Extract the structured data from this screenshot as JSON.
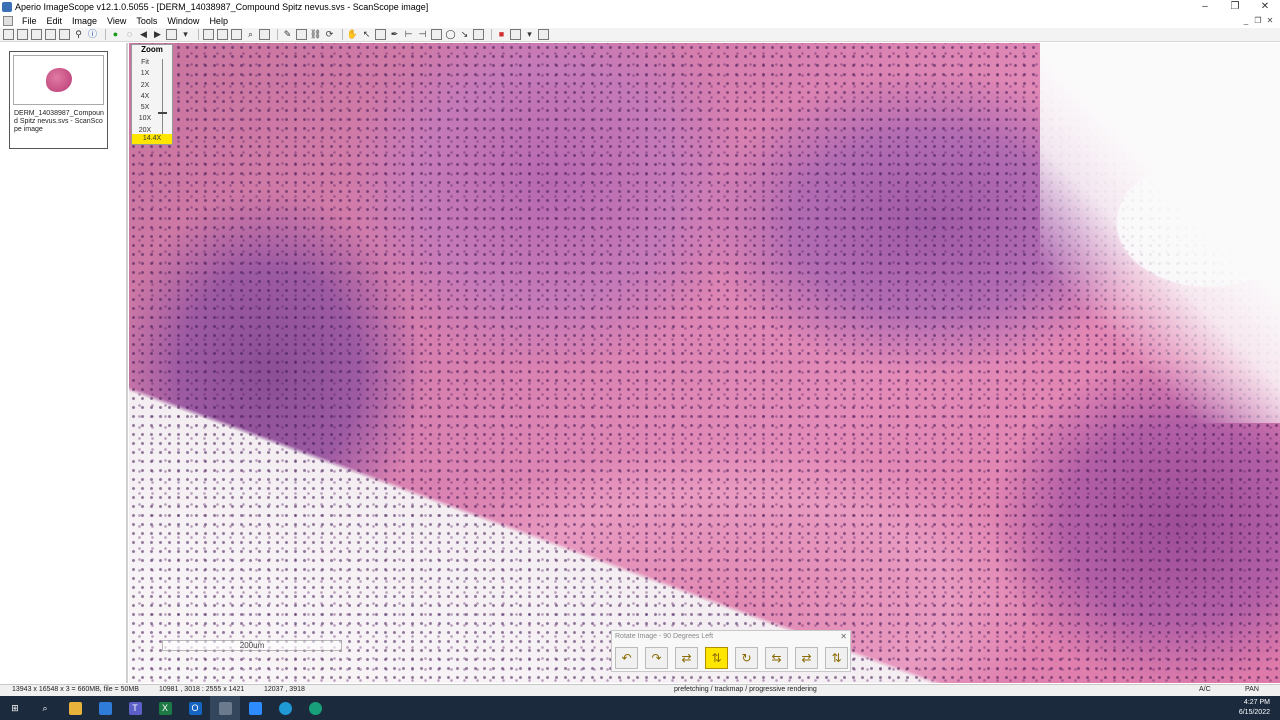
{
  "window": {
    "title": "Aperio ImageScope v12.1.0.5055 - [DERM_14038987_Compound Spitz nevus.svs - ScanScope image]",
    "minimize": "–",
    "restore": "❐",
    "close": "✕"
  },
  "menu": {
    "items": [
      "File",
      "Edit",
      "Image",
      "View",
      "Tools",
      "Window",
      "Help"
    ]
  },
  "mdi": {
    "minimize": "_",
    "restore": "❐",
    "close": "✕"
  },
  "thumbnail": {
    "label": "DERM_14038987_Compound Spitz nevus.svs - ScanScope image"
  },
  "zoom": {
    "title": "Zoom",
    "levels": [
      "Fit",
      "1X",
      "2X",
      "4X",
      "5X",
      "10X",
      "20X"
    ],
    "current": "14.4X",
    "fraction": 0.72
  },
  "scalebar": {
    "label": "200um"
  },
  "rotate_toolbar": {
    "caption": "Rotate Image - 90 Degrees Left",
    "close": "✕",
    "buttons": [
      {
        "name": "rotate-left-icon",
        "glyph": "↶"
      },
      {
        "name": "rotate-right-icon",
        "glyph": "↷"
      },
      {
        "name": "flip-horizontal-icon",
        "glyph": "⇄"
      },
      {
        "name": "flip-vertical-icon",
        "glyph": "⇅"
      },
      {
        "name": "rotate-180-icon",
        "glyph": "↻"
      },
      {
        "name": "mirror-left-icon",
        "glyph": "⇆"
      },
      {
        "name": "mirror-right-icon",
        "glyph": "⇄"
      },
      {
        "name": "mirror-vertical-icon",
        "glyph": "⇅"
      }
    ],
    "active_index": 3
  },
  "statusbar": {
    "image_info": "13943 x 16548 x 3 = 660MB, file = 50MB",
    "view_info": "10981 , 3018 : 2555 x 1421",
    "cursor": "12037 , 3918",
    "message": "prefetching / trackmap / progressive rendering",
    "ac": "A/C",
    "mode": "PAN"
  },
  "taskbar": {
    "time": "4:27 PM",
    "date": "6/15/2022"
  },
  "colors": {
    "zoom_highlight": "#ffe600",
    "taskbar": "#1b2a3d"
  }
}
